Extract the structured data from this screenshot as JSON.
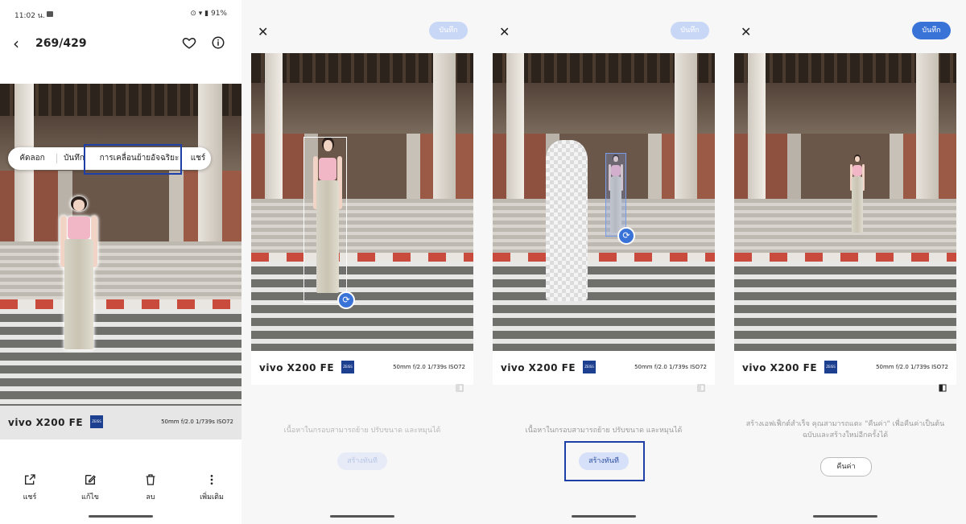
{
  "panel1": {
    "status": {
      "time": "11:02 น.",
      "battery": "91%"
    },
    "header": {
      "count": "269/429"
    },
    "menu": {
      "copy": "คัดลอก",
      "save": "บันทึก",
      "smart_move": "การเคลื่อนย้ายอัจฉริยะ",
      "share": "แชร์"
    },
    "watermark": {
      "brand": "vivo X200 FE",
      "zeiss": "ZEISS",
      "specs": "50mm  f/2.0  1/739s  ISO72"
    },
    "bottom": {
      "share": "แชร์",
      "edit": "แก้ไข",
      "delete": "ลบ",
      "more": "เพิ่มเติม"
    }
  },
  "panel2": {
    "save_label": "บันทึก",
    "watermark": {
      "brand": "vivo X200 FE",
      "zeiss": "ZEISS",
      "specs": "50mm  f/2.0  1/739s  ISO72"
    },
    "hint": "เนื้อหาในกรอบสามารถย้าย ปรับขนาด และหมุนได้",
    "create_label": "สร้างทันที"
  },
  "panel3": {
    "save_label": "บันทึก",
    "watermark": {
      "brand": "vivo X200 FE",
      "zeiss": "ZEISS",
      "specs": "50mm  f/2.0  1/739s  ISO72"
    },
    "hint": "เนื้อหาในกรอบสามารถย้าย ปรับขนาด และหมุนได้",
    "create_label": "สร้างทันที"
  },
  "panel4": {
    "save_label": "บันทึก",
    "watermark": {
      "brand": "vivo X200 FE",
      "zeiss": "ZEISS",
      "specs": "50mm  f/2.0  1/739s  ISO72"
    },
    "hint_line1": "สร้างเอฟเฟ็กต์สำเร็จ คุณสามารถแตะ \"คืนค่า\" เพื่อคืนค่าเป็นต้น",
    "hint_line2": "ฉบับและสร้างใหม่อีกครั้งได้",
    "restore_label": "คืนค่า"
  },
  "colors": {
    "accent": "#3a73d8",
    "highlight": "#1f3fa8"
  },
  "icons": [
    "back-arrow-icon",
    "heart-icon",
    "info-icon",
    "share-icon",
    "edit-icon",
    "delete-icon",
    "more-icon",
    "close-icon",
    "rotate-icon",
    "compare-icon"
  ]
}
